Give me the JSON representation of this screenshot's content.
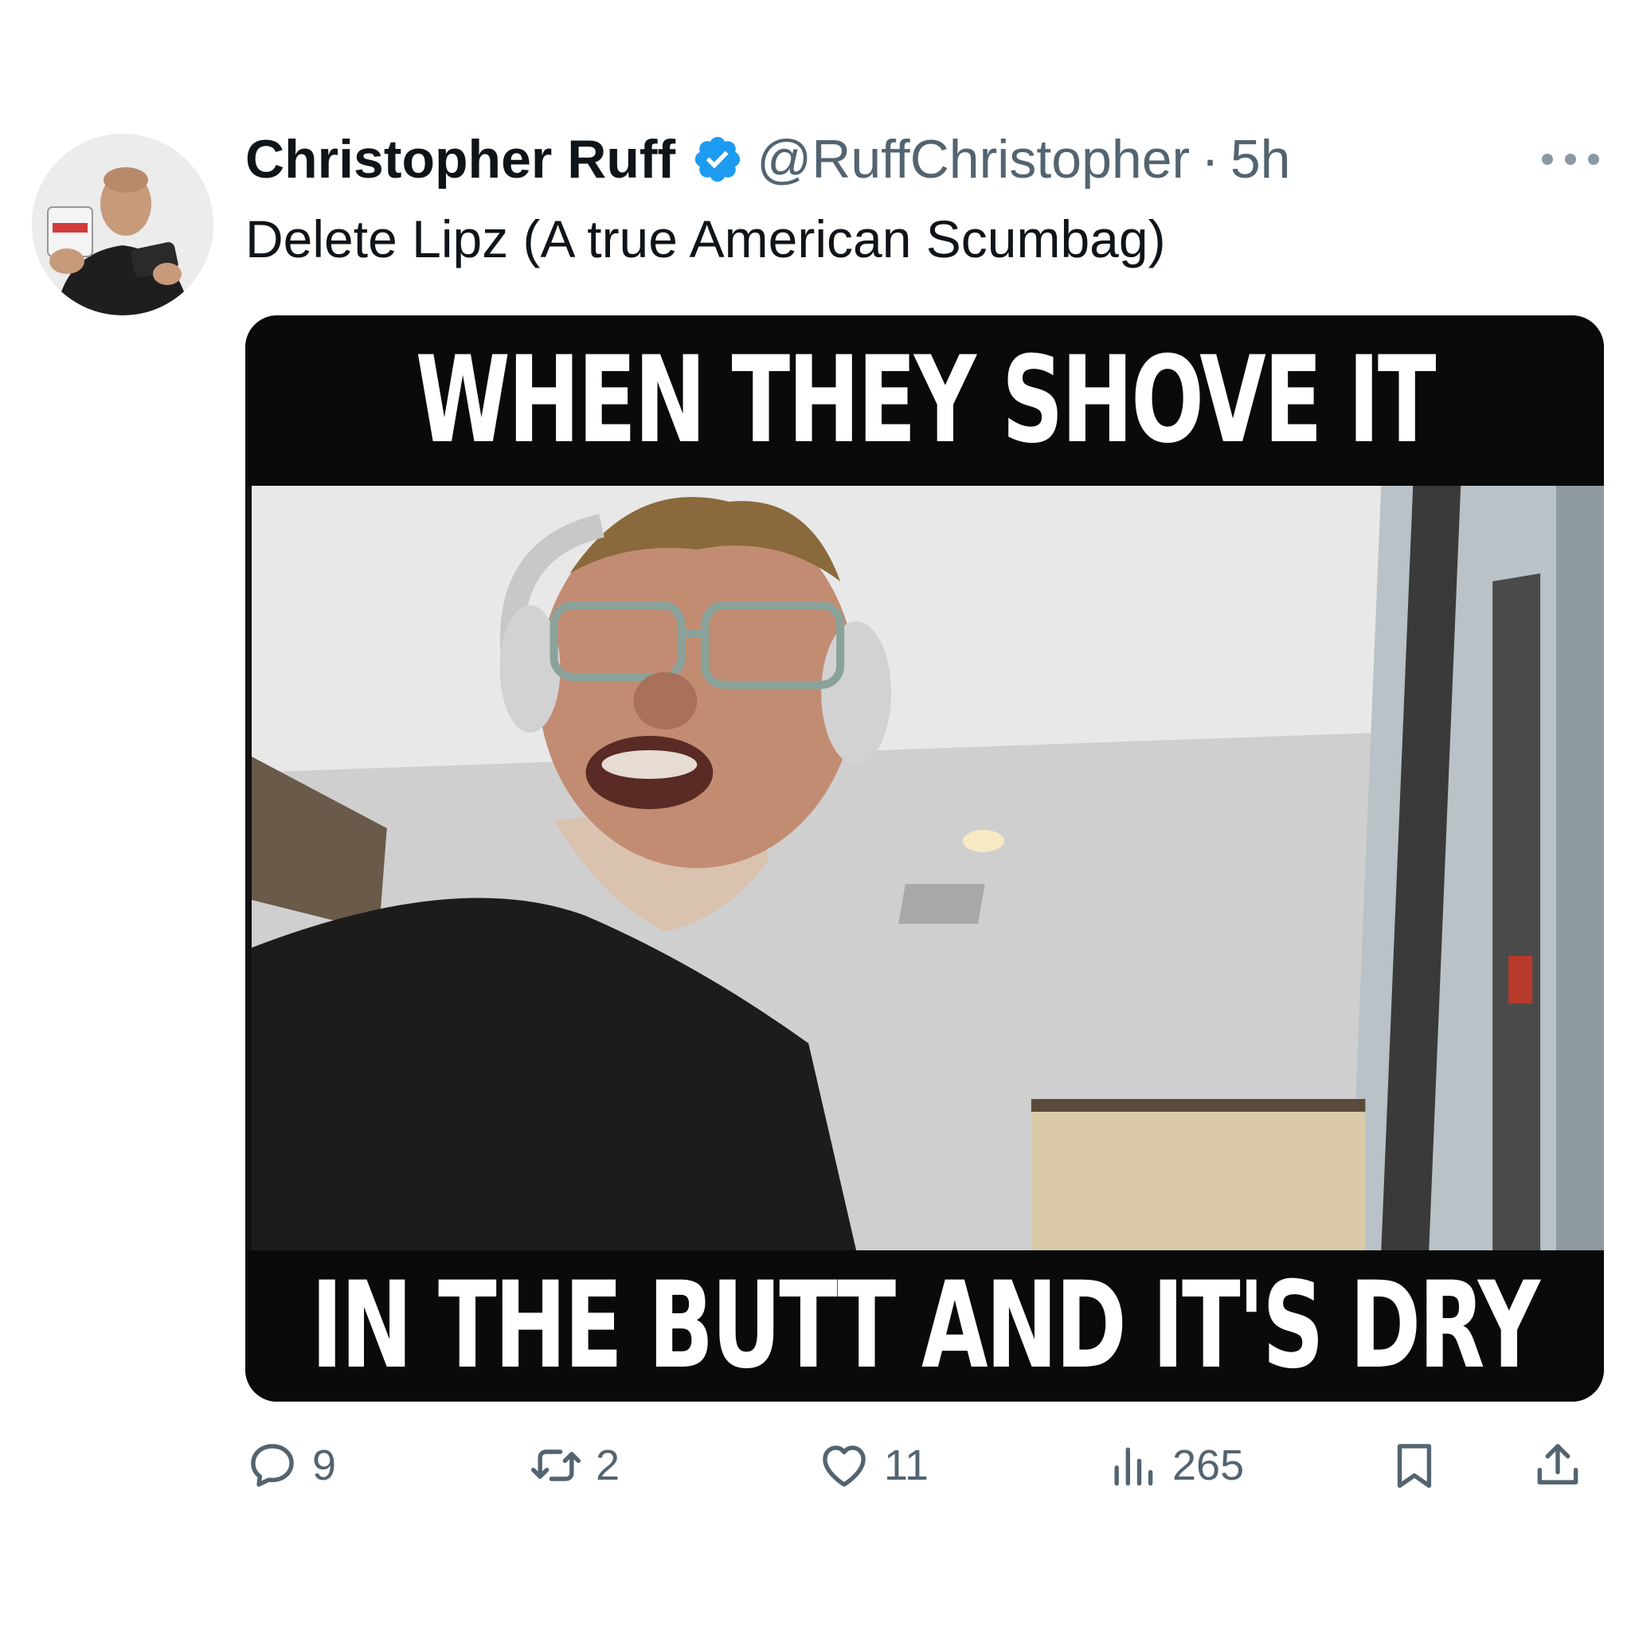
{
  "tweet": {
    "author": {
      "display_name": "Christopher Ruff",
      "handle": "@RuffChristopher",
      "verified": true,
      "avatar_icon": "profile-photo"
    },
    "separator": "·",
    "timestamp": "5h",
    "text": "Delete Lipz (A true American Scumbag)",
    "media": {
      "caption_top": "WHEN THEY SHOVE IT",
      "caption_bottom": "IN THE BUTT AND IT'S DRY"
    },
    "actions": {
      "reply": {
        "icon": "reply-icon",
        "count": "9"
      },
      "retweet": {
        "icon": "retweet-icon",
        "count": "2"
      },
      "like": {
        "icon": "heart-icon",
        "count": "11"
      },
      "views": {
        "icon": "views-chart-icon",
        "count": "265"
      },
      "bookmark": {
        "icon": "bookmark-icon"
      },
      "share": {
        "icon": "share-icon"
      }
    }
  },
  "colors": {
    "text_primary": "#0f1419",
    "text_secondary": "#536471",
    "verified_blue": "#1d9bf0",
    "caption_bar": "#0a0a0a"
  }
}
